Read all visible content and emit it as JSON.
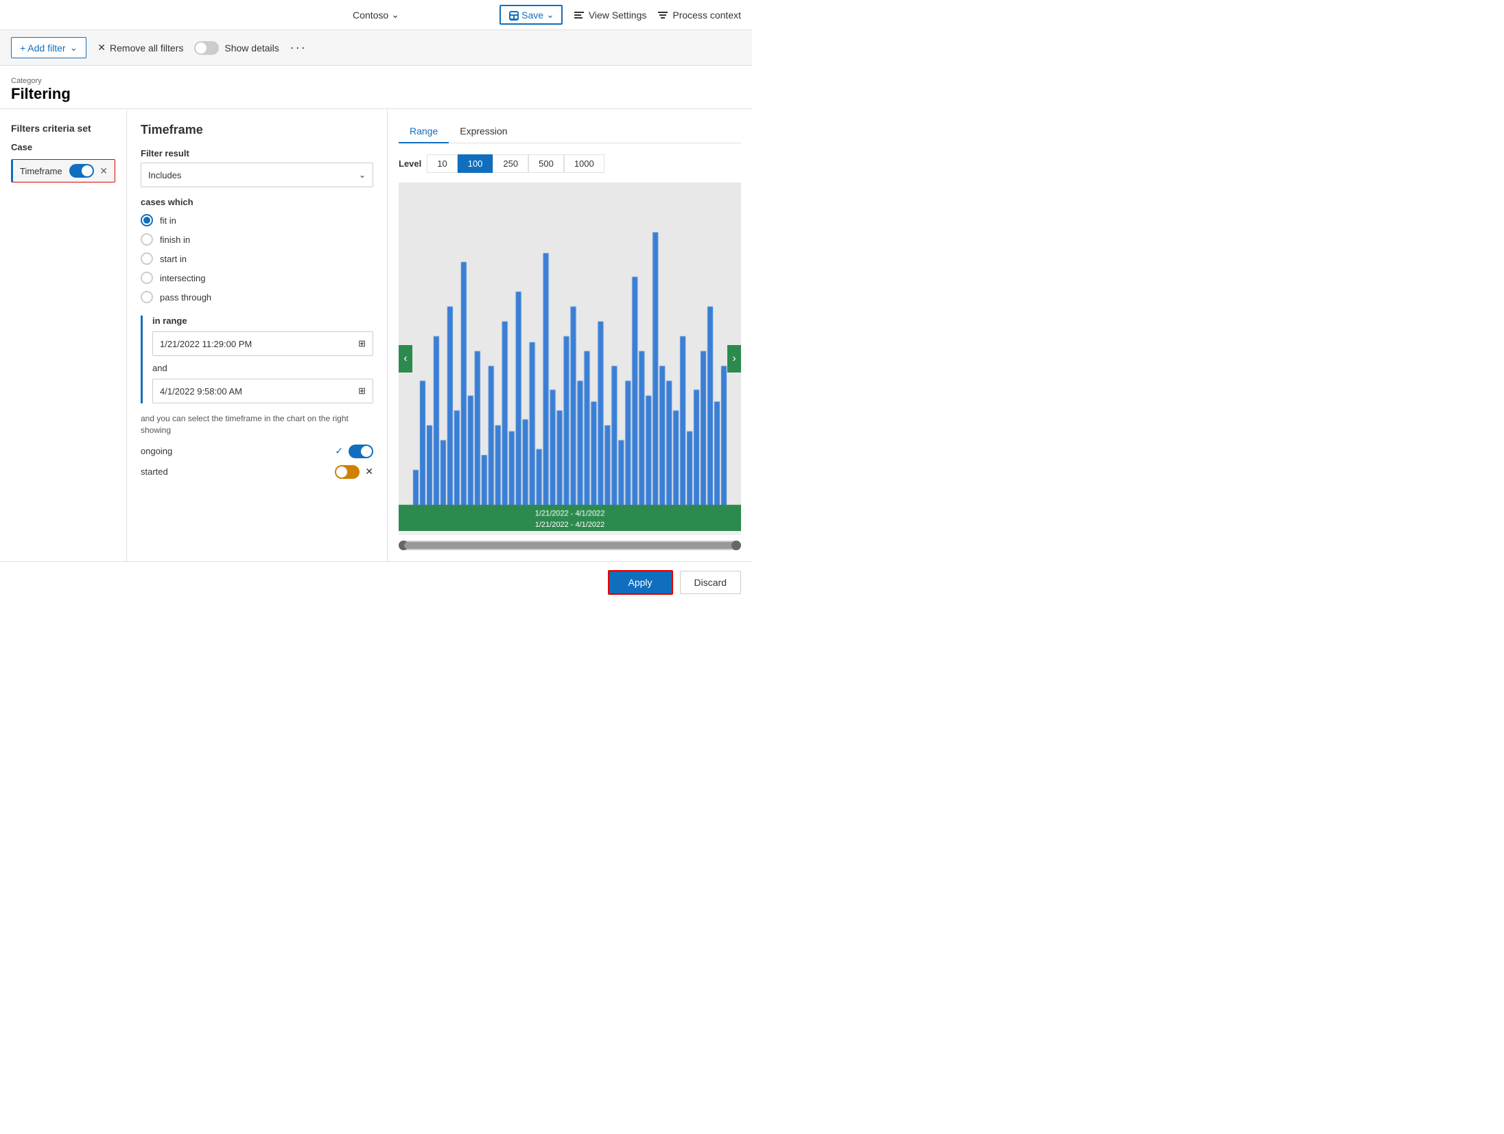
{
  "topNav": {
    "company": "Contoso",
    "saveLabel": "Save",
    "viewSettingsLabel": "View Settings",
    "processContextLabel": "Process context"
  },
  "filterBar": {
    "addFilterLabel": "+ Add filter",
    "removeFiltersLabel": "Remove all filters",
    "showDetailsLabel": "Show details"
  },
  "category": {
    "label": "Category",
    "title": "Filtering"
  },
  "leftPanel": {
    "criteriaTitle": "Filters criteria set",
    "caseLabel": "Case",
    "filterItem": "Timeframe"
  },
  "midPanel": {
    "title": "Timeframe",
    "filterResultLabel": "Filter result",
    "filterResultValue": "Includes",
    "casesWhichLabel": "cases which",
    "radioOptions": [
      "fit in",
      "finish in",
      "start in",
      "intersecting",
      "pass through"
    ],
    "selectedRadio": 0,
    "inRangeLabel": "in range",
    "date1": "1/21/2022 11:29:00 PM",
    "andLabel": "and",
    "date2": "4/1/2022 9:58:00 AM",
    "infoText": "and you can select the timeframe in the chart on the right showing",
    "ongoingLabel": "ongoing",
    "startedLabel": "started"
  },
  "rightPanel": {
    "tabs": [
      "Range",
      "Expression"
    ],
    "activeTab": 0,
    "levelLabel": "Level",
    "levelOptions": [
      "10",
      "100",
      "250",
      "500",
      "1000"
    ],
    "activeLevelIndex": 1,
    "chartDateLabel": "1/21/2022 - 4/1/2022",
    "chartBars": [
      15,
      45,
      30,
      60,
      25,
      70,
      35,
      85,
      40,
      55,
      20,
      50,
      30,
      65,
      28,
      75,
      32,
      58,
      22,
      88,
      42,
      35,
      60,
      70,
      45,
      55,
      38,
      65,
      30,
      50,
      25,
      45,
      80,
      55,
      40,
      95,
      50,
      45,
      35,
      60,
      28,
      42,
      55,
      70,
      38,
      50
    ]
  },
  "bottomActions": {
    "applyLabel": "Apply",
    "discardLabel": "Discard"
  }
}
